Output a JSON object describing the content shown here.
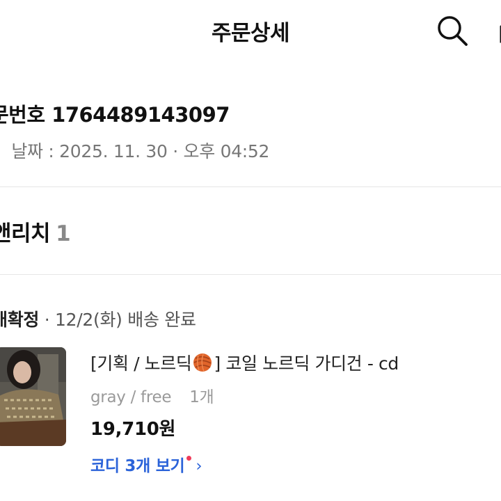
{
  "header": {
    "title": "주문상세",
    "search_icon": "search-icon",
    "cart_icon": "shopping-bag-icon"
  },
  "order": {
    "number_text": "문번호 1764489143097",
    "date_text": "ㅣ 날짜 : 2025. 11. 30 · 오후 04:52"
  },
  "shop": {
    "name": "앤리치",
    "count": "1"
  },
  "shipment": {
    "status": "매확정",
    "detail": " · 12/2(화) 배송 완료"
  },
  "product": {
    "name_prefix": "[기획 / 노르딕",
    "name_suffix": "] 코일 노르딕 가디건 - cd",
    "option": "gray / free",
    "quantity": "1개",
    "price": "19,710원",
    "coordi_link": "코디 3개 보기",
    "emoji_icon": "yarn-ball-icon"
  },
  "colors": {
    "link": "#2b63d9",
    "notification_dot": "#ef3b5a",
    "yarn": "#e0642a"
  }
}
